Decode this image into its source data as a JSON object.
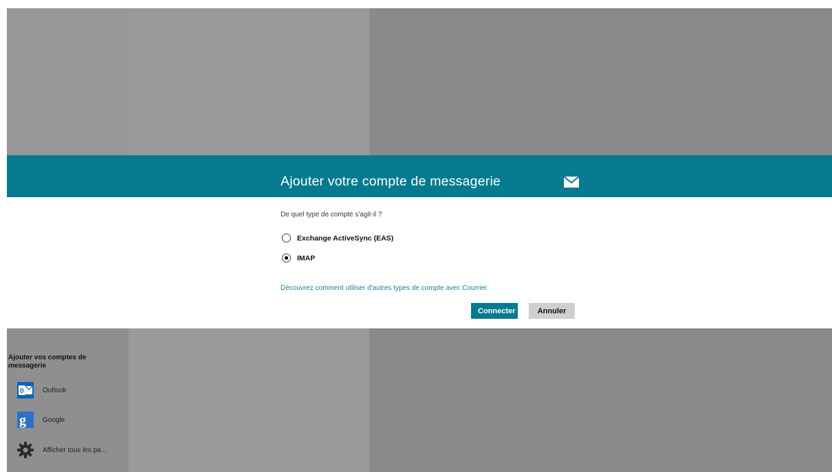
{
  "dialog": {
    "title": "Ajouter votre compte de messagerie",
    "question": "De quel type de compte s'agit-il ?",
    "options": [
      {
        "label": "Exchange ActiveSync (EAS)",
        "selected": false
      },
      {
        "label": "IMAP",
        "selected": true
      }
    ],
    "link": "Découvrez comment utiliser d'autres types de compte avec Courrier.",
    "buttons": {
      "connect": "Connecter",
      "cancel": "Annuler"
    }
  },
  "sidebar": {
    "title": "Ajouter vos comptes de messagerie",
    "accounts": [
      {
        "label": "Outlook",
        "icon": "outlook-icon"
      },
      {
        "label": "Google",
        "icon": "google-icon"
      },
      {
        "label": "Afficher tous les pa...",
        "icon": "gear-icon"
      }
    ]
  },
  "colors": {
    "accent": "#057a90",
    "button_secondary": "#cfcfcf",
    "overlay": "#8a8a8a"
  }
}
